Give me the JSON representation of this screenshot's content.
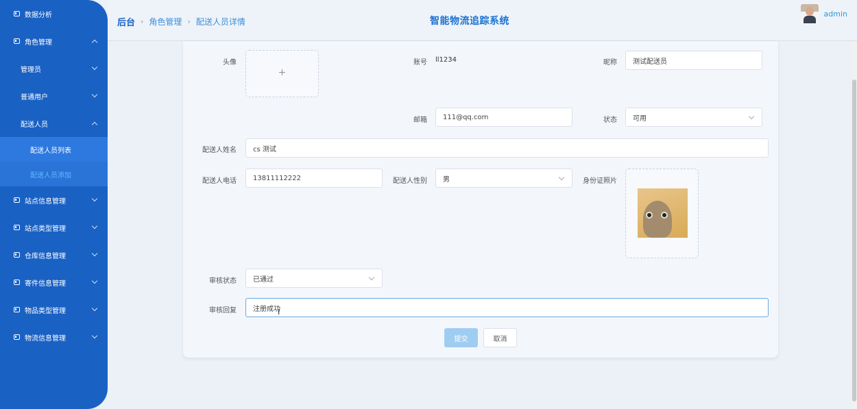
{
  "sidebar": {
    "items": [
      {
        "label": "数据分析"
      },
      {
        "label": "角色管理"
      },
      {
        "label": "管理员"
      },
      {
        "label": "普通用户"
      },
      {
        "label": "配送人员"
      },
      {
        "label": "配送人员列表"
      },
      {
        "label": "配送人员添加"
      },
      {
        "label": "站点信息管理"
      },
      {
        "label": "站点类型管理"
      },
      {
        "label": "仓库信息管理"
      },
      {
        "label": "寄件信息管理"
      },
      {
        "label": "物品类型管理"
      },
      {
        "label": "物流信息管理"
      }
    ]
  },
  "header": {
    "breadcrumb": [
      "后台",
      "角色管理",
      "配送人员详情"
    ],
    "separator": "›",
    "title": "智能物流追踪系统",
    "username": "admin"
  },
  "form": {
    "avatar_label": "头像",
    "avatar_plus": "+",
    "account_label": "账号",
    "account_value": "ll1234",
    "nickname_label": "昵称",
    "nickname_value": "测试配送员",
    "email_label": "邮箱",
    "email_value": "111@qq.com",
    "status_label": "状态",
    "status_value": "可用",
    "name_label": "配送人姓名",
    "name_value": "cs 测试",
    "phone_label": "配送人电话",
    "phone_value": "13811112222",
    "gender_label": "配送人性别",
    "gender_value": "男",
    "idphoto_label": "身份证照片",
    "audit_status_label": "审核状态",
    "audit_status_value": "已通过",
    "audit_reply_label": "审核回复",
    "audit_reply_value": "注册成功"
  },
  "buttons": {
    "submit": "提交",
    "cancel": "取消"
  }
}
